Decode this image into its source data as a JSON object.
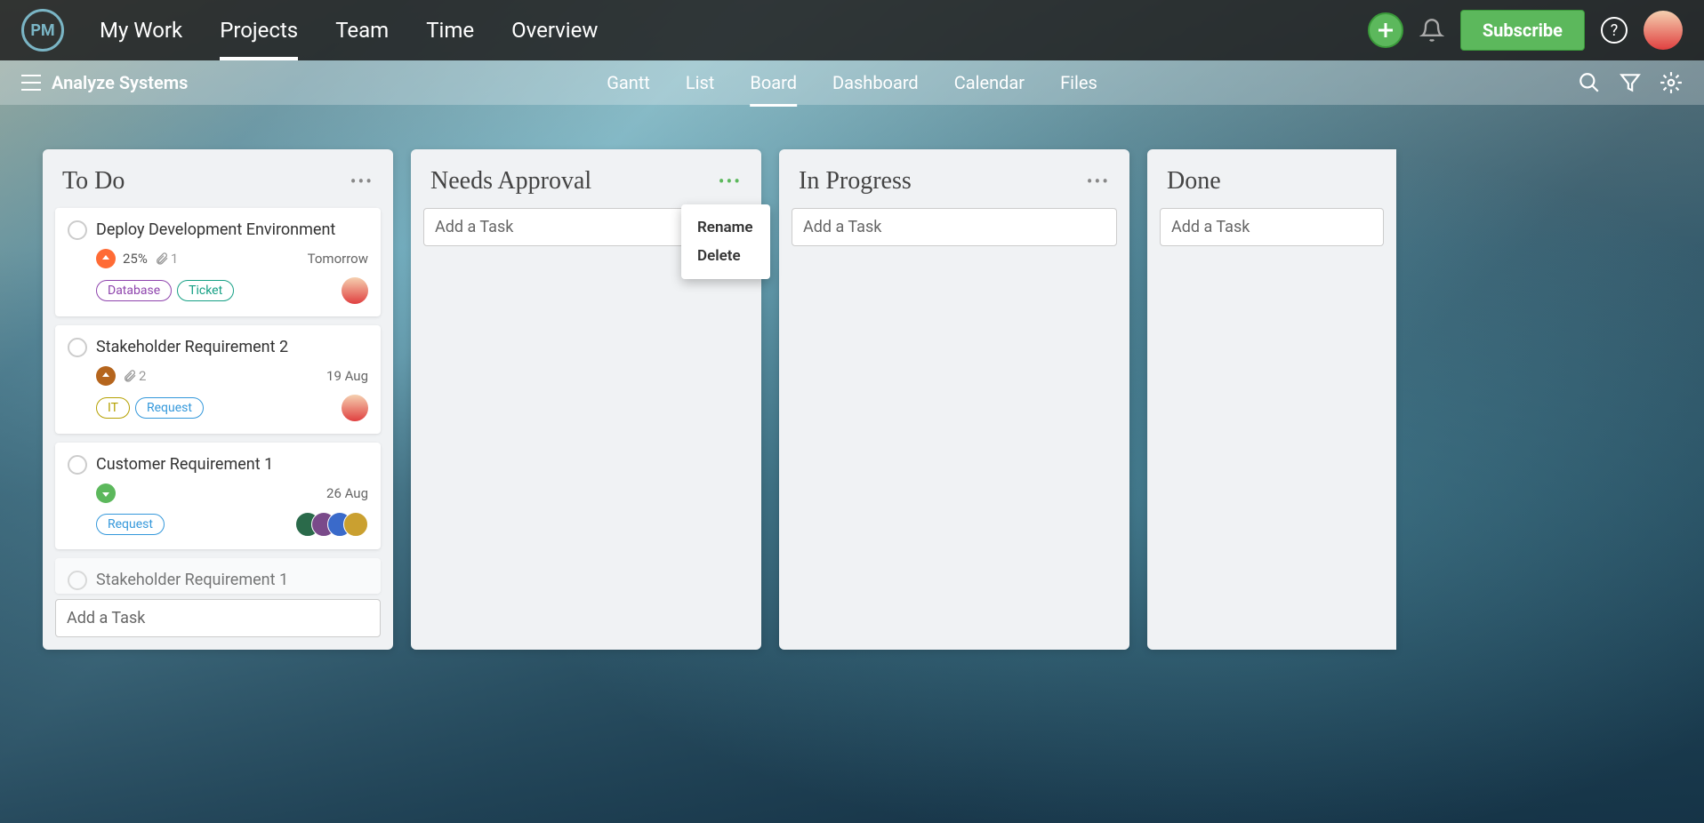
{
  "nav": {
    "items": [
      "My Work",
      "Projects",
      "Team",
      "Time",
      "Overview"
    ],
    "active": 1,
    "subscribe": "Subscribe"
  },
  "subbar": {
    "project": "Analyze Systems",
    "views": [
      "Gantt",
      "List",
      "Board",
      "Dashboard",
      "Calendar",
      "Files"
    ],
    "active": 2
  },
  "columns": [
    {
      "title": "To Do",
      "addTask": "Add a Task",
      "cards": [
        {
          "title": "Deploy Development Environment",
          "priority": "high",
          "percent": "25%",
          "attachments": "1",
          "due": "Tomorrow",
          "tags": [
            {
              "label": "Database",
              "cls": "database"
            },
            {
              "label": "Ticket",
              "cls": "ticket"
            }
          ],
          "avatar": "single"
        },
        {
          "title": "Stakeholder Requirement 2",
          "priority": "med",
          "attachments": "2",
          "due": "19 Aug",
          "tags": [
            {
              "label": "IT",
              "cls": "it"
            },
            {
              "label": "Request",
              "cls": "request"
            }
          ],
          "avatar": "single"
        },
        {
          "title": "Customer Requirement 1",
          "priority": "low",
          "due": "26 Aug",
          "tags": [
            {
              "label": "Request",
              "cls": "request"
            }
          ],
          "avatar": "stack"
        },
        {
          "title": "Stakeholder Requirement 1",
          "faded": true
        }
      ]
    },
    {
      "title": "Needs Approval",
      "addTask": "Add a Task",
      "menuOpen": true
    },
    {
      "title": "In Progress",
      "addTask": "Add a Task"
    },
    {
      "title": "Done",
      "addTask": "Add a Task"
    }
  ],
  "dropdown": {
    "rename": "Rename",
    "delete": "Delete"
  }
}
